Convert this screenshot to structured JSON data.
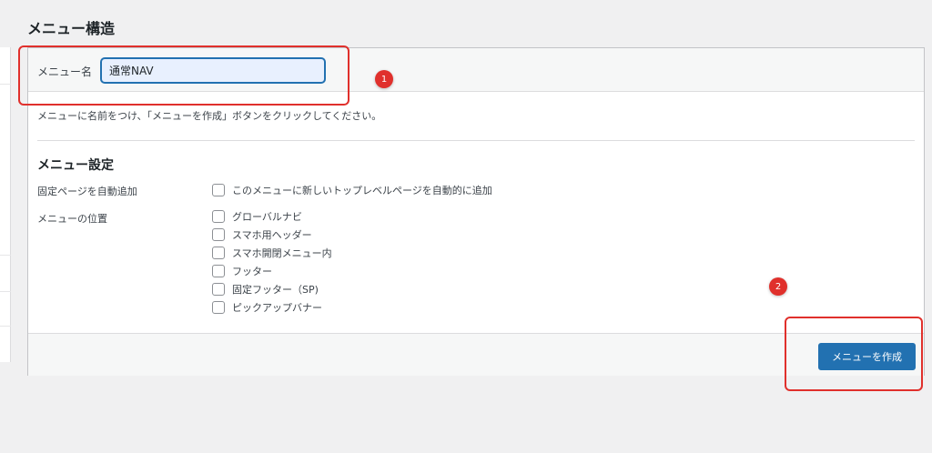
{
  "page": {
    "title": "メニュー構造"
  },
  "menu_name": {
    "label": "メニュー名",
    "value": "通常NAV"
  },
  "instructions": "メニューに名前をつけ、「メニューを作成」ボタンをクリックしてください。",
  "settings": {
    "title": "メニュー設定",
    "auto_add": {
      "label": "固定ページを自動追加",
      "option": {
        "label": "このメニューに新しいトップレベルページを自動的に追加",
        "checked": false
      }
    },
    "location": {
      "label": "メニューの位置",
      "options": [
        {
          "label": "グローバルナビ",
          "checked": false
        },
        {
          "label": "スマホ用ヘッダー",
          "checked": false
        },
        {
          "label": "スマホ開閉メニュー内",
          "checked": false
        },
        {
          "label": "フッター",
          "checked": false
        },
        {
          "label": "固定フッター（SP)",
          "checked": false
        },
        {
          "label": "ピックアップバナー",
          "checked": false
        }
      ]
    }
  },
  "actions": {
    "create_label": "メニューを作成"
  },
  "annotations": {
    "marker1": "1",
    "marker2": "2",
    "color": "#e0302c"
  },
  "colors": {
    "accent": "#2271b1",
    "background": "#f0f0f1"
  }
}
